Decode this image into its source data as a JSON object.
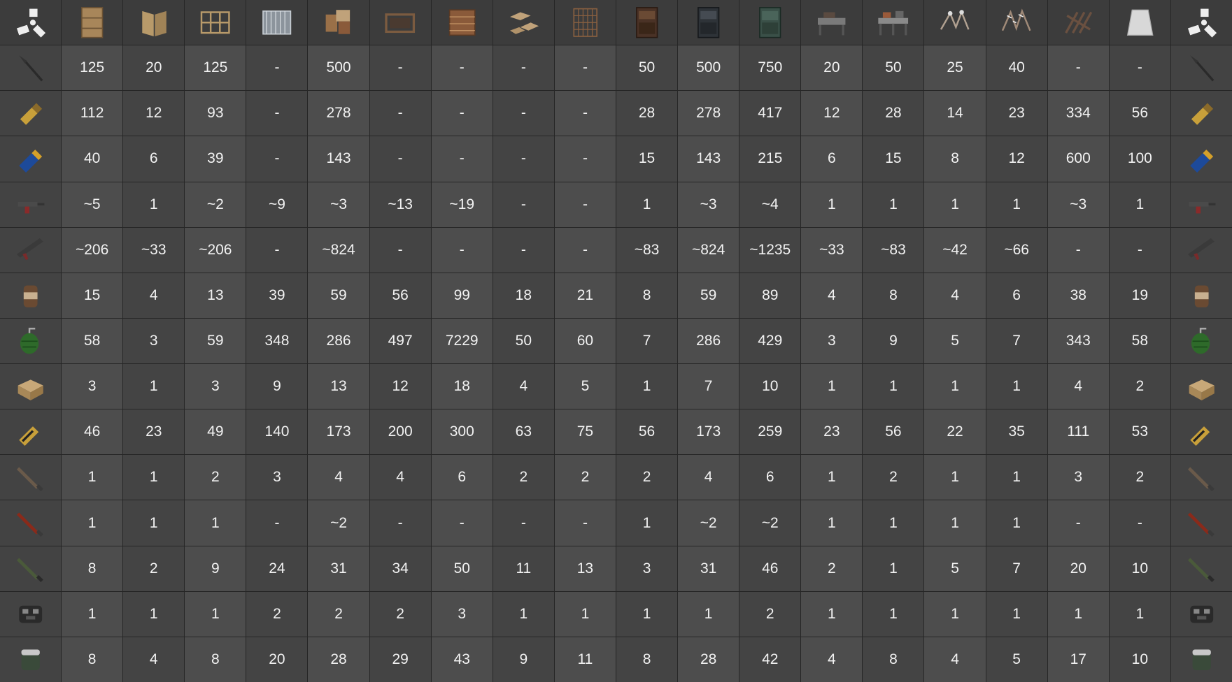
{
  "columns": [
    {
      "icon": "wooden-door-icon"
    },
    {
      "icon": "wooden-hatch-icon"
    },
    {
      "icon": "wooden-window-bars-icon"
    },
    {
      "icon": "metal-window-bars-icon"
    },
    {
      "icon": "wooden-barricade-icon"
    },
    {
      "icon": "metal-barricade-icon"
    },
    {
      "icon": "metal-crate-icon"
    },
    {
      "icon": "wooden-floor-spikes-icon"
    },
    {
      "icon": "metal-cage-icon"
    },
    {
      "icon": "wooden-cabinet-icon"
    },
    {
      "icon": "metal-cabinet-icon"
    },
    {
      "icon": "armored-cabinet-icon"
    },
    {
      "icon": "workbench-1-icon"
    },
    {
      "icon": "workbench-2-icon"
    },
    {
      "icon": "barbed-barricade-icon"
    },
    {
      "icon": "spiked-barricade-icon"
    },
    {
      "icon": "wooden-chevaux-icon"
    },
    {
      "icon": "concrete-barricade-icon"
    }
  ],
  "rows": [
    {
      "icon": "spear-icon",
      "values": [
        "125",
        "20",
        "125",
        "-",
        "500",
        "-",
        "-",
        "-",
        "-",
        "50",
        "500",
        "750",
        "20",
        "50",
        "25",
        "40",
        "-",
        "-"
      ]
    },
    {
      "icon": "incendiary-ammo-icon",
      "values": [
        "112",
        "12",
        "93",
        "-",
        "278",
        "-",
        "-",
        "-",
        "-",
        "28",
        "278",
        "417",
        "12",
        "28",
        "14",
        "23",
        "334",
        "56"
      ]
    },
    {
      "icon": "shotgun-shell-icon",
      "values": [
        "40",
        "6",
        "39",
        "-",
        "143",
        "-",
        "-",
        "-",
        "-",
        "15",
        "143",
        "215",
        "6",
        "15",
        "8",
        "12",
        "600",
        "100"
      ]
    },
    {
      "icon": "revolver-icon",
      "values": [
        "~5",
        "1",
        "~2",
        "~9",
        "~3",
        "~13",
        "~19",
        "-",
        "-",
        "1",
        "~3",
        "~4",
        "1",
        "1",
        "1",
        "1",
        "~3",
        "1"
      ]
    },
    {
      "icon": "assault-rifle-icon",
      "values": [
        "~206",
        "~33",
        "~206",
        "-",
        "~824",
        "-",
        "-",
        "-",
        "-",
        "~83",
        "~824",
        "~1235",
        "~33",
        "~83",
        "~42",
        "~66",
        "-",
        "-"
      ]
    },
    {
      "icon": "beancan-grenade-icon",
      "values": [
        "15",
        "4",
        "13",
        "39",
        "59",
        "56",
        "99",
        "18",
        "21",
        "8",
        "59",
        "89",
        "4",
        "8",
        "4",
        "6",
        "38",
        "19"
      ]
    },
    {
      "icon": "f1-grenade-icon",
      "values": [
        "58",
        "3",
        "59",
        "348",
        "286",
        "497",
        "7229",
        "50",
        "60",
        "7",
        "286",
        "429",
        "3",
        "9",
        "5",
        "7",
        "343",
        "58"
      ]
    },
    {
      "icon": "satchel-charge-icon",
      "values": [
        "3",
        "1",
        "3",
        "9",
        "13",
        "12",
        "18",
        "4",
        "5",
        "1",
        "7",
        "10",
        "1",
        "1",
        "1",
        "1",
        "4",
        "2"
      ]
    },
    {
      "icon": "explosive-ammo-icon",
      "values": [
        "46",
        "23",
        "49",
        "140",
        "173",
        "200",
        "300",
        "63",
        "75",
        "56",
        "173",
        "259",
        "23",
        "56",
        "22",
        "35",
        "111",
        "53"
      ]
    },
    {
      "icon": "rocket-icon",
      "values": [
        "1",
        "1",
        "2",
        "3",
        "4",
        "4",
        "6",
        "2",
        "2",
        "2",
        "4",
        "6",
        "1",
        "2",
        "1",
        "1",
        "3",
        "2"
      ]
    },
    {
      "icon": "incendiary-rocket-icon",
      "values": [
        "1",
        "1",
        "1",
        "-",
        "~2",
        "-",
        "-",
        "-",
        "-",
        "1",
        "~2",
        "~2",
        "1",
        "1",
        "1",
        "1",
        "-",
        "-"
      ]
    },
    {
      "icon": "hv-rocket-icon",
      "values": [
        "8",
        "2",
        "9",
        "24",
        "31",
        "34",
        "50",
        "11",
        "13",
        "3",
        "31",
        "46",
        "2",
        "1",
        "5",
        "7",
        "20",
        "10"
      ]
    },
    {
      "icon": "c4-icon",
      "values": [
        "1",
        "1",
        "1",
        "2",
        "2",
        "2",
        "3",
        "1",
        "1",
        "1",
        "1",
        "2",
        "1",
        "1",
        "1",
        "1",
        "1",
        "1"
      ]
    },
    {
      "icon": "grenade-launcher-round-icon",
      "values": [
        "8",
        "4",
        "8",
        "20",
        "28",
        "29",
        "43",
        "9",
        "11",
        "8",
        "28",
        "42",
        "4",
        "8",
        "4",
        "5",
        "17",
        "10"
      ]
    }
  ],
  "colors": {
    "cell_a": "#4d4d4d",
    "cell_b": "#444444",
    "header": "#3c3c3c",
    "text": "#f2f2f2"
  },
  "logo_icon": "rust-logo-icon"
}
